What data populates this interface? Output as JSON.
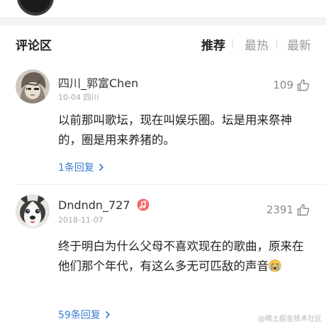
{
  "header": {
    "title": "评论区",
    "sort_tabs": [
      "推荐",
      "最热",
      "最新"
    ],
    "active_tab": "推荐"
  },
  "comments": [
    {
      "username": "四川_郭富Chen",
      "date": "10-04",
      "location": "四川",
      "likes": "109",
      "text": "以前那叫歌坛，现在叫娱乐圈。坛是用来祭神的，圈是用来养猪的。",
      "replies": "1条回复"
    },
    {
      "username": "Dndndn_727",
      "date": "2018-11-07",
      "likes": "2391",
      "text": "终于明白为什么父母不喜欢现在的歌曲，原来在他们那个年代，有这么多无可匹敌的声音",
      "replies": "59条回复"
    }
  ],
  "watermark": "@稀土掘金技术社区",
  "colors": {
    "link": "#3a7bd5",
    "badge": "#f26b6b",
    "divider": "#ececec"
  },
  "icons": {
    "like": "thumbs-up-icon",
    "reply_arrow": "chevron-right-icon",
    "badge": "music-badge-icon",
    "emoji": "crying-emoji-icon"
  }
}
